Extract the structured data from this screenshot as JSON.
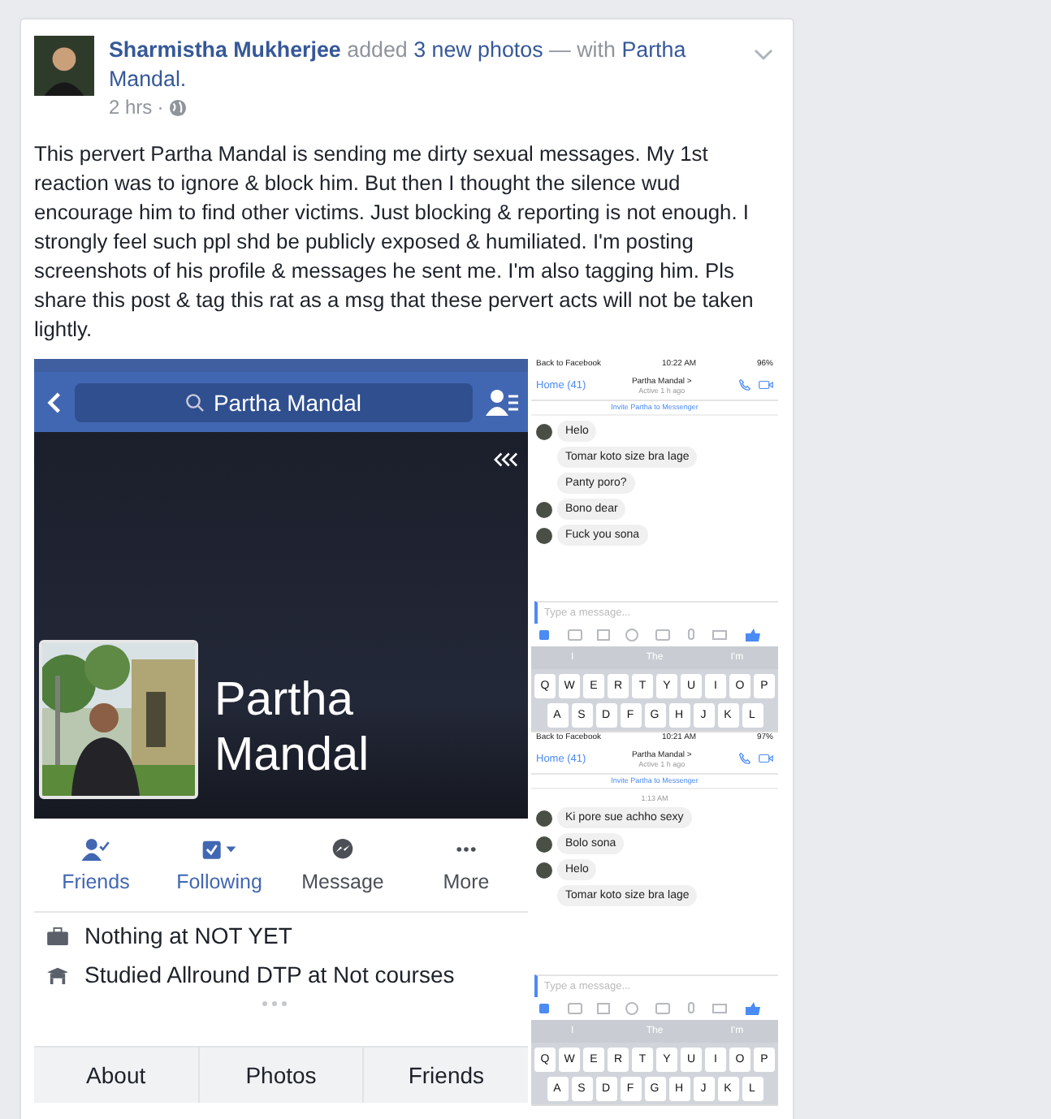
{
  "post": {
    "author": "Sharmistha Mukherjee",
    "action": "added",
    "photos_link": "3 new photos",
    "with_text": "— with",
    "tagged": "Partha Mandal.",
    "time": "2 hrs",
    "separator": "·",
    "body": "This pervert Partha Mandal is sending me dirty sexual messages. My 1st reaction was to ignore & block him. But then I thought the silence wud encourage him to find other victims. Just blocking & reporting is not enough. I strongly feel such ppl shd be publicly exposed & humiliated. I'm posting screenshots of his profile & messages he sent me. I'm also tagging him. Pls share this post & tag this rat as a msg that these pervert acts will not be taken lightly."
  },
  "profile_screenshot": {
    "search": "Partha Mandal",
    "name": "Partha Mandal",
    "actions": [
      {
        "kind": "friends",
        "label": "Friends",
        "active": true
      },
      {
        "kind": "following",
        "label": "Following",
        "active": true
      },
      {
        "kind": "message",
        "label": "Message",
        "active": false
      },
      {
        "kind": "more",
        "label": "More",
        "active": false
      }
    ],
    "info": [
      {
        "kind": "work",
        "text": "Nothing at NOT YET"
      },
      {
        "kind": "education",
        "text": "Studied Allround DTP at Not courses"
      }
    ],
    "tabs": [
      "About",
      "Photos",
      "Friends"
    ]
  },
  "chat_screenshots": [
    {
      "back_app": "Back to Facebook",
      "time": "10:22 AM",
      "battery": "96%",
      "back": "Home (41)",
      "contact": "Partha Mandal >",
      "status": "Active 1 h ago",
      "invite": "Invite Partha to Messenger",
      "messages": [
        {
          "text": "Helo",
          "avatar": true
        },
        {
          "text": "Tomar koto size bra lage",
          "avatar": false
        },
        {
          "text": "Panty poro?",
          "avatar": false
        },
        {
          "text": "Bono dear",
          "avatar": true
        },
        {
          "text": "Fuck you sona",
          "avatar": true
        }
      ],
      "placeholder": "Type a message...",
      "suggestions": [
        "I",
        "The",
        "I'm"
      ],
      "keys": [
        [
          "Q",
          "W",
          "E",
          "R",
          "T",
          "Y",
          "U",
          "I",
          "O",
          "P"
        ],
        [
          "A",
          "S",
          "D",
          "F",
          "G",
          "H",
          "J",
          "K",
          "L"
        ]
      ]
    },
    {
      "back_app": "Back to Facebook",
      "time": "10:21 AM",
      "battery": "97%",
      "back": "Home (41)",
      "contact": "Partha Mandal >",
      "status": "Active 1 h ago",
      "invite": "Invite Partha to Messenger",
      "timestamp": "1:13 AM",
      "messages": [
        {
          "text": "Ki pore sue achho sexy",
          "avatar": true
        },
        {
          "text": "Bolo sona",
          "avatar": true
        },
        {
          "text": "Helo",
          "avatar": true
        },
        {
          "text": "Tomar koto size bra lage",
          "avatar": false
        }
      ],
      "placeholder": "Type a message...",
      "suggestions": [
        "I",
        "The",
        "I'm"
      ],
      "keys": [
        [
          "Q",
          "W",
          "E",
          "R",
          "T",
          "Y",
          "U",
          "I",
          "O",
          "P"
        ],
        [
          "A",
          "S",
          "D",
          "F",
          "G",
          "H",
          "J",
          "K",
          "L"
        ]
      ]
    }
  ]
}
